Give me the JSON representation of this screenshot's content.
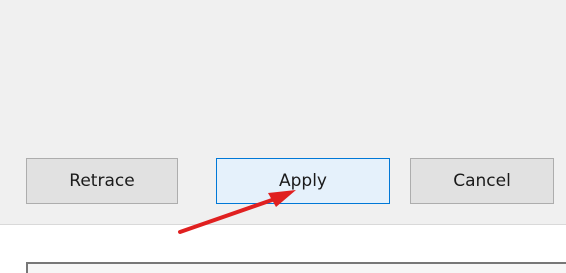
{
  "buttons": {
    "retrace_label": "Retrace",
    "apply_label": "Apply",
    "cancel_label": "Cancel"
  },
  "colors": {
    "panel_background": "#f0f0f0",
    "button_face": "#e1e1e1",
    "focused_button_face": "#e5f1fb",
    "focused_button_border": "#0078d7",
    "annotation_arrow": "#e02020"
  },
  "icons": {
    "annotation": "red-arrow-icon"
  }
}
